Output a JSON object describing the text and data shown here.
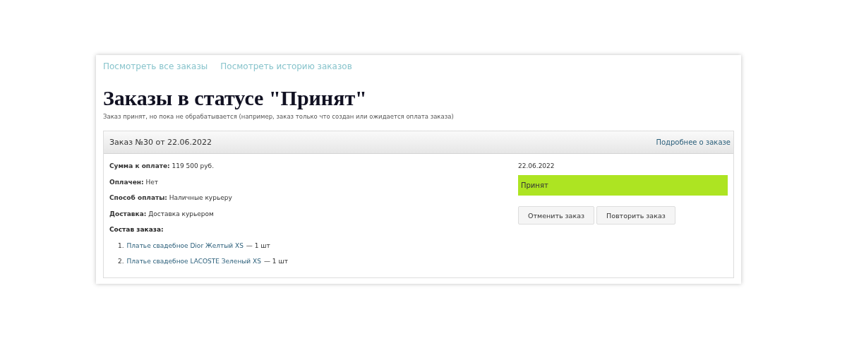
{
  "nav_links": [
    "Посмотреть все заказы",
    "Посмотреть историю заказов"
  ],
  "title": "Заказы в статусе \"Принят\"",
  "description": "Заказ принят, но пока не обрабатывается (например, заказ только что создан или ожидается оплата заказа)",
  "order": {
    "heading": "Заказ №30 от 22.06.2022",
    "details_link": "Подробнее о заказе",
    "fields": [
      "**Сумма к оплате:** 119 500 руб.",
      "**Оплачен:** Нет",
      "**Способ оплаты:** Наличные курьеру",
      "**Доставка:** Доставка курьером"
    ],
    "items_label": "Состав заказа:",
    "items": [
      {
        "number": "1.",
        "name": "Платье свадебное Dior Желтый XS",
        "quantity": "— 1 шт"
      },
      {
        "number": "2.",
        "name": "Платье свадебное LACOSTE Зеленый XS",
        "quantity": "— 1 шт"
      }
    ],
    "date": "22.06.2022",
    "status": {
      "label": "Принят",
      "color": "#ade422"
    },
    "buttons": [
      "Отменить заказ",
      "Повторить заказ"
    ]
  }
}
